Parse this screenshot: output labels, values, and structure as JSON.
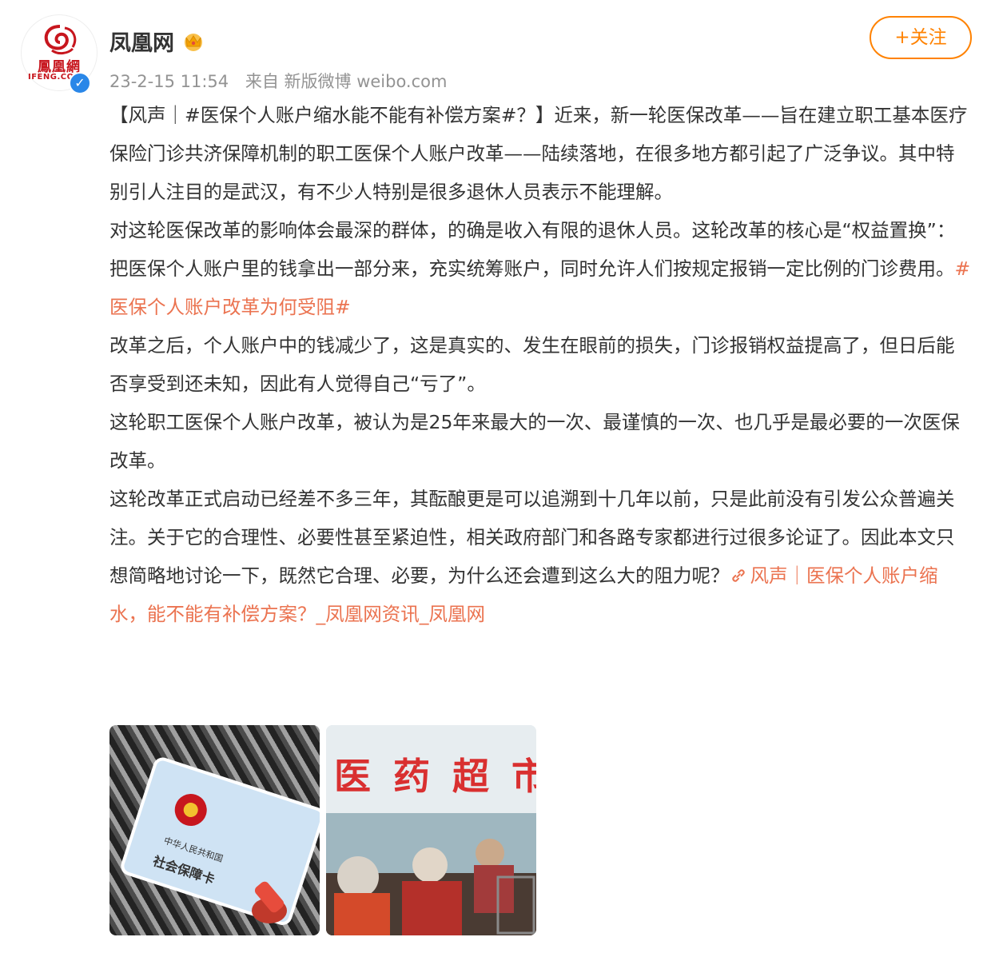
{
  "user": {
    "name": "凤凰网",
    "avatar_text_cn": "鳳凰網",
    "avatar_text_en": "IFENG.CO",
    "verified_icon": "check-icon",
    "vip_icon": "crown-icon"
  },
  "post_meta": {
    "timestamp": "23-2-15 11:54",
    "source": "来自 新版微博 weibo.com"
  },
  "follow_button": {
    "label": "+关注"
  },
  "content": {
    "p1": "【风声｜#医保个人账户缩水能不能有补偿方案#？】近来，新一轮医保改革——旨在建立职工基本医疗保险门诊共济保障机制的职工医保个人账户改革——陆续落地，在很多地方都引起了广泛争议。其中特别引人注目的是武汉，有不少人特别是很多退休人员表示不能理解。",
    "p2a": "对这轮医保改革的影响体会最深的群体，的确是收入有限的退休人员。这轮改革的核心是“权益置换”：把医保个人账户里的钱拿出一部分来，充实统筹账户，同时允许人们按规定报销一定比例的门诊费用。",
    "p2_tag": "#医保个人账户改革为何受阻#",
    "p3": "改革之后，个人账户中的钱减少了，这是真实的、发生在眼前的损失，门诊报销权益提高了，但日后能否享受到还未知，因此有人觉得自己“亏了”。",
    "p4": "这轮职工医保个人账户改革，被认为是25年来最大的一次、最谨慎的一次、也几乎是最必要的一次医保改革。",
    "p5": "这轮改革正式启动已经差不多三年，其酝酿更是可以追溯到十几年以前，只是此前没有引发公众普遍关注。关于它的合理性、必要性甚至紧迫性，相关政府部门和各路专家都进行过很多论证了。因此本文只想简略地讨论一下，既然它合理、必要，为什么还会遭到这么大的阻力呢？",
    "link_text": "风声｜医保个人账户缩水，能不能有补偿方案？_凤凰网资讯_凤凰网"
  },
  "images": {
    "pic1_card_text1": "中华人民共和国",
    "pic1_card_text2": "社会保障卡",
    "pic2_sign": "医 药 超 市"
  },
  "colors": {
    "accent": "#ff8200",
    "link": "#eb7350",
    "meta": "#939393",
    "text": "#333333"
  }
}
